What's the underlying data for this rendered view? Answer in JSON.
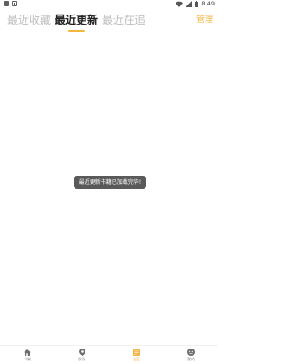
{
  "status_bar": {
    "time": "8:49"
  },
  "tabs": [
    {
      "label": "最近收藏",
      "active": false
    },
    {
      "label": "最近更新",
      "active": true
    },
    {
      "label": "最近在追",
      "active": false
    }
  ],
  "header": {
    "manage_label": "管理"
  },
  "toast": {
    "message": "最近更新书籍已加载完毕!"
  },
  "bottom_nav": [
    {
      "label": "书架",
      "icon": "home-icon",
      "active": false
    },
    {
      "label": "发现",
      "icon": "discover-icon",
      "active": false
    },
    {
      "label": "追更",
      "icon": "updates-icon",
      "active": true
    },
    {
      "label": "我的",
      "icon": "profile-icon",
      "active": false
    }
  ],
  "colors": {
    "accent": "#f2b646",
    "active_tab_text": "#222222",
    "inactive_tab_text": "#bdbdbd",
    "toast_bg": "#4d4d4d"
  }
}
